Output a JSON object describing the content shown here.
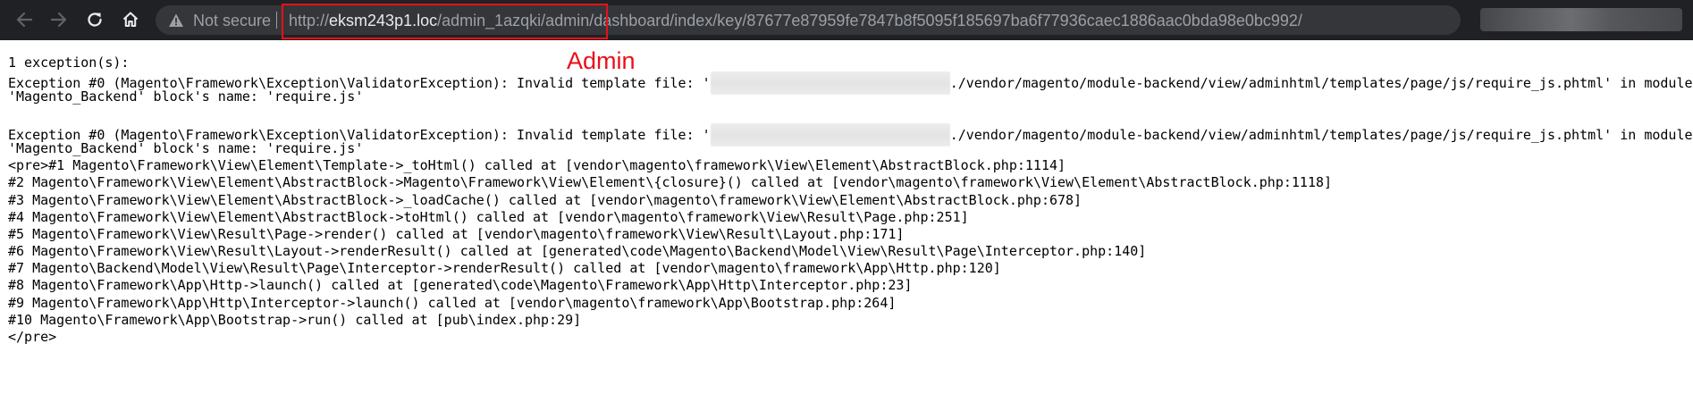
{
  "browser": {
    "security_label": "Not secure",
    "url": {
      "scheme": "http://",
      "host": "eksm243p1.loc",
      "path": "/admin_1azqki/admin/dashboard/index/key/87677e87959fe7847b8f5095f185697ba6f77936caec1886aac0bda98e0bc992/"
    },
    "icons": {
      "back": "back-arrow-icon",
      "forward": "forward-arrow-icon",
      "reload": "reload-icon",
      "home": "home-icon",
      "security": "info-icon",
      "bookmark": "star-icon"
    }
  },
  "annotation": {
    "label": "Admin",
    "color": "#e8101a"
  },
  "page": {
    "summary": "1 exception(s):",
    "exception_1": {
      "prefix": "Exception #0 (Magento\\Framework\\Exception\\ValidatorException): Invalid template file: '",
      "suffix": "./vendor/magento/module-backend/view/adminhtml/templates/page/js/require_js.phtml' in module:",
      "line2": "'Magento_Backend' block's name: 'require.js'"
    },
    "exception_2": {
      "prefix": "Exception #0 (Magento\\Framework\\Exception\\ValidatorException): Invalid template file: '",
      "suffix": "./vendor/magento/module-backend/view/adminhtml/templates/page/js/require_js.phtml' in module:",
      "line2": "'Magento_Backend' block's name: 'require.js'"
    },
    "trace": [
      "<pre>#1 Magento\\Framework\\View\\Element\\Template->_toHtml() called at [vendor\\magento\\framework\\View\\Element\\AbstractBlock.php:1114]",
      "#2 Magento\\Framework\\View\\Element\\AbstractBlock->Magento\\Framework\\View\\Element\\{closure}() called at [vendor\\magento\\framework\\View\\Element\\AbstractBlock.php:1118]",
      "#3 Magento\\Framework\\View\\Element\\AbstractBlock->_loadCache() called at [vendor\\magento\\framework\\View\\Element\\AbstractBlock.php:678]",
      "#4 Magento\\Framework\\View\\Element\\AbstractBlock->toHtml() called at [vendor\\magento\\framework\\View\\Result\\Page.php:251]",
      "#5 Magento\\Framework\\View\\Result\\Page->render() called at [vendor\\magento\\framework\\View\\Result\\Layout.php:171]",
      "#6 Magento\\Framework\\View\\Result\\Layout->renderResult() called at [generated\\code\\Magento\\Backend\\Model\\View\\Result\\Page\\Interceptor.php:140]",
      "#7 Magento\\Backend\\Model\\View\\Result\\Page\\Interceptor->renderResult() called at [vendor\\magento\\framework\\App\\Http.php:120]",
      "#8 Magento\\Framework\\App\\Http->launch() called at [generated\\code\\Magento\\Framework\\App\\Http\\Interceptor.php:23]",
      "#9 Magento\\Framework\\App\\Http\\Interceptor->launch() called at [vendor\\magento\\framework\\App\\Bootstrap.php:264]",
      "#10 Magento\\Framework\\App\\Bootstrap->run() called at [pub\\index.php:29]",
      "</pre>"
    ]
  }
}
